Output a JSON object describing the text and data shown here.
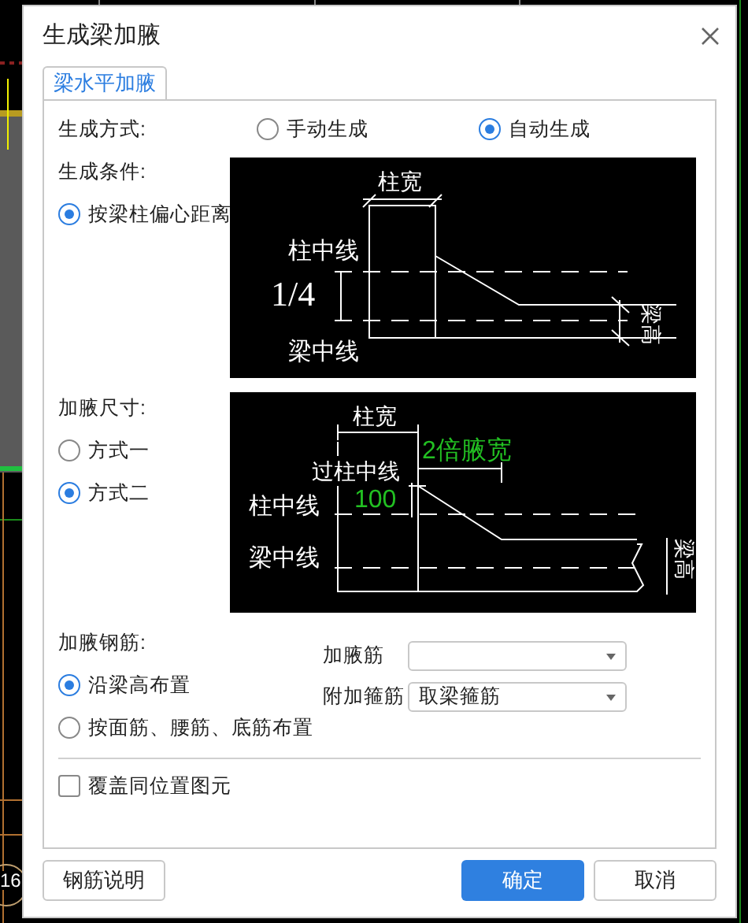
{
  "window": {
    "title": "生成梁加腋"
  },
  "tabs": [
    {
      "label": "梁水平加腋",
      "selected": true
    }
  ],
  "generation_method": {
    "label": "生成方式:",
    "options": [
      {
        "label": "手动生成",
        "selected": false
      },
      {
        "label": "自动生成",
        "selected": true
      }
    ]
  },
  "generation_condition": {
    "label": "生成条件:",
    "options": [
      {
        "label": "按梁柱偏心距离",
        "selected": true
      }
    ],
    "diagram": {
      "labels": [
        {
          "text": "柱宽",
          "color": "#ffffff"
        },
        {
          "text": "柱中线",
          "color": "#ffffff"
        },
        {
          "text": "1/4",
          "color": "#ffffff"
        },
        {
          "text": "梁中线",
          "color": "#ffffff"
        },
        {
          "text": "梁高",
          "color": "#ffffff"
        }
      ]
    }
  },
  "haunch_size": {
    "label": "加腋尺寸:",
    "options": [
      {
        "label": "方式一",
        "selected": false
      },
      {
        "label": "方式二",
        "selected": true
      }
    ],
    "diagram": {
      "labels": [
        {
          "text": "柱宽",
          "color": "#ffffff"
        },
        {
          "text": "2倍腋宽",
          "color": "#22c022"
        },
        {
          "text": "过柱中线",
          "color": "#ffffff"
        },
        {
          "text": "100",
          "color": "#22c022"
        },
        {
          "text": "柱中线",
          "color": "#ffffff"
        },
        {
          "text": "梁中线",
          "color": "#ffffff"
        },
        {
          "text": "梁高",
          "color": "#ffffff"
        }
      ]
    }
  },
  "haunch_rebar": {
    "label": "加腋钢筋:",
    "options": [
      {
        "label": "沿梁高布置",
        "selected": true
      },
      {
        "label": "按面筋、腰筋、底筋布置",
        "selected": false
      }
    ],
    "fields": [
      {
        "label": "加腋筋"
      },
      {
        "label": "附加箍筋",
        "value": "取梁箍筋"
      }
    ]
  },
  "overwrite": {
    "label": "覆盖同位置图元",
    "checked": false
  },
  "buttons": [
    {
      "label": "钢筋说明",
      "kind": "secondary"
    },
    {
      "label": "确定",
      "kind": "primary"
    },
    {
      "label": "取消",
      "kind": "secondary"
    }
  ],
  "background": {
    "marker": "16"
  }
}
